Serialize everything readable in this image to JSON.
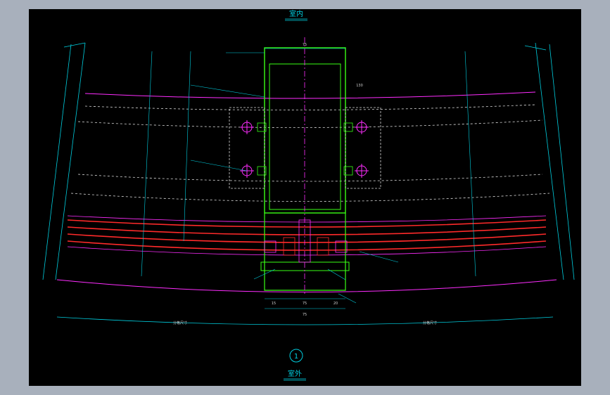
{
  "titles": {
    "top": "室内",
    "bottom": "室外",
    "section_number": "1"
  },
  "colors": {
    "background_outer": "#a8b0bc",
    "canvas": "#000000",
    "frame_green": "#39ff14",
    "glass_red": "#ff2a2a",
    "magenta": "#ff2dff",
    "cyan_dim": "#00cfe0",
    "dashed_white": "#d8d8d8",
    "label_text": "#cfcfcf"
  },
  "glyph_labels": {
    "top_dim": "75",
    "right_dim": "130",
    "bottom_dim_left": "15",
    "bottom_dim_mid": "75",
    "bottom_dim_right": "20",
    "bottom_total": "75",
    "left_extent": "分格尺寸",
    "right_extent": "分格尺寸"
  }
}
